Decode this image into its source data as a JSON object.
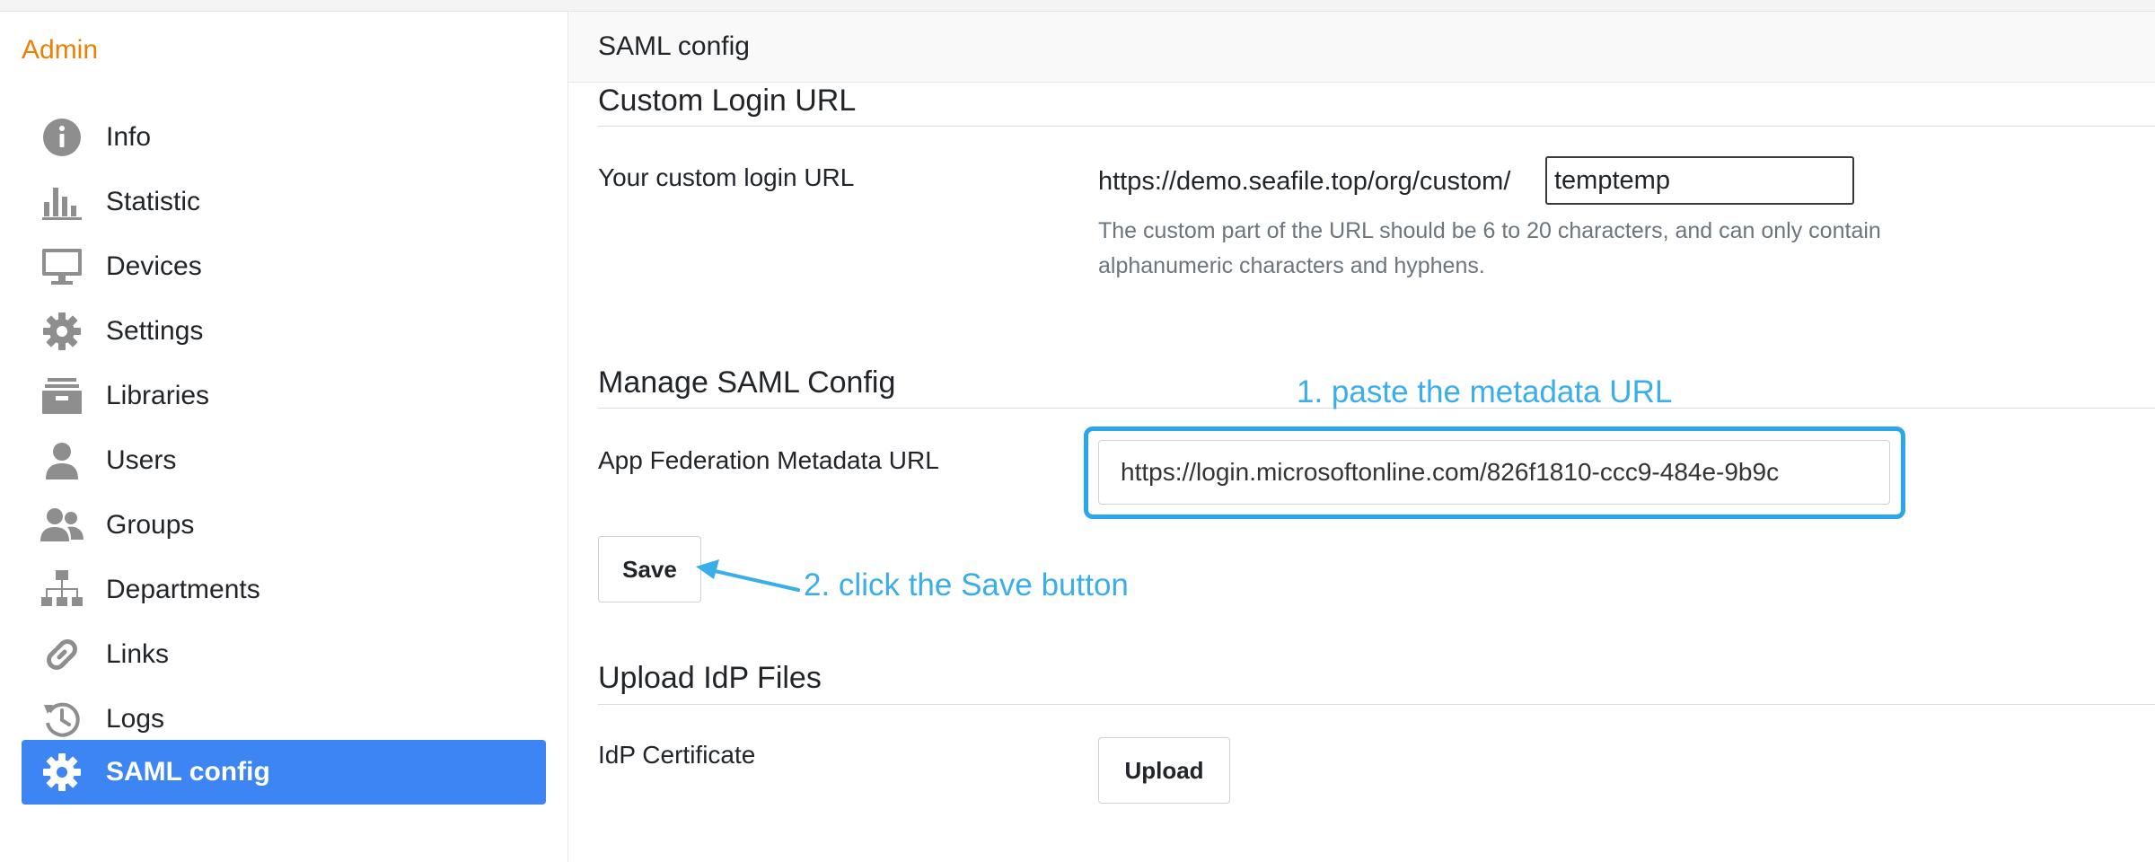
{
  "sidebar": {
    "title": "Admin",
    "items": [
      {
        "label": "Info",
        "icon": "info-icon"
      },
      {
        "label": "Statistic",
        "icon": "bar-chart-icon"
      },
      {
        "label": "Devices",
        "icon": "monitor-icon"
      },
      {
        "label": "Settings",
        "icon": "gear-icon"
      },
      {
        "label": "Libraries",
        "icon": "archive-icon"
      },
      {
        "label": "Users",
        "icon": "user-icon"
      },
      {
        "label": "Groups",
        "icon": "users-icon"
      },
      {
        "label": "Departments",
        "icon": "org-chart-icon"
      },
      {
        "label": "Links",
        "icon": "link-icon"
      },
      {
        "label": "Logs",
        "icon": "history-icon"
      },
      {
        "label": "SAML config",
        "icon": "gear-icon",
        "active": true
      }
    ]
  },
  "page": {
    "title": "SAML config"
  },
  "custom_login": {
    "section_title": "Custom Login URL",
    "label": "Your custom login URL",
    "url_prefix": "https://demo.seafile.top/org/custom/",
    "value": "temptemp",
    "help": "The custom part of the URL should be 6 to 20 characters, and can only contain alphanumeric characters and hyphens."
  },
  "saml": {
    "section_title": "Manage SAML Config",
    "label": "App Federation Metadata URL",
    "value": "https://login.microsoftonline.com/826f1810-ccc9-484e-9b9c",
    "save_label": "Save"
  },
  "idp": {
    "section_title": "Upload IdP Files",
    "label": "IdP Certificate",
    "upload_label": "Upload"
  },
  "annotations": {
    "step1": "1. paste the metadata URL",
    "step2": "2. click the Save button",
    "color": "#3aaeea"
  },
  "colors": {
    "accent": "#3d85f2",
    "brand": "#ec8000",
    "annotation": "#2aa6ee"
  }
}
